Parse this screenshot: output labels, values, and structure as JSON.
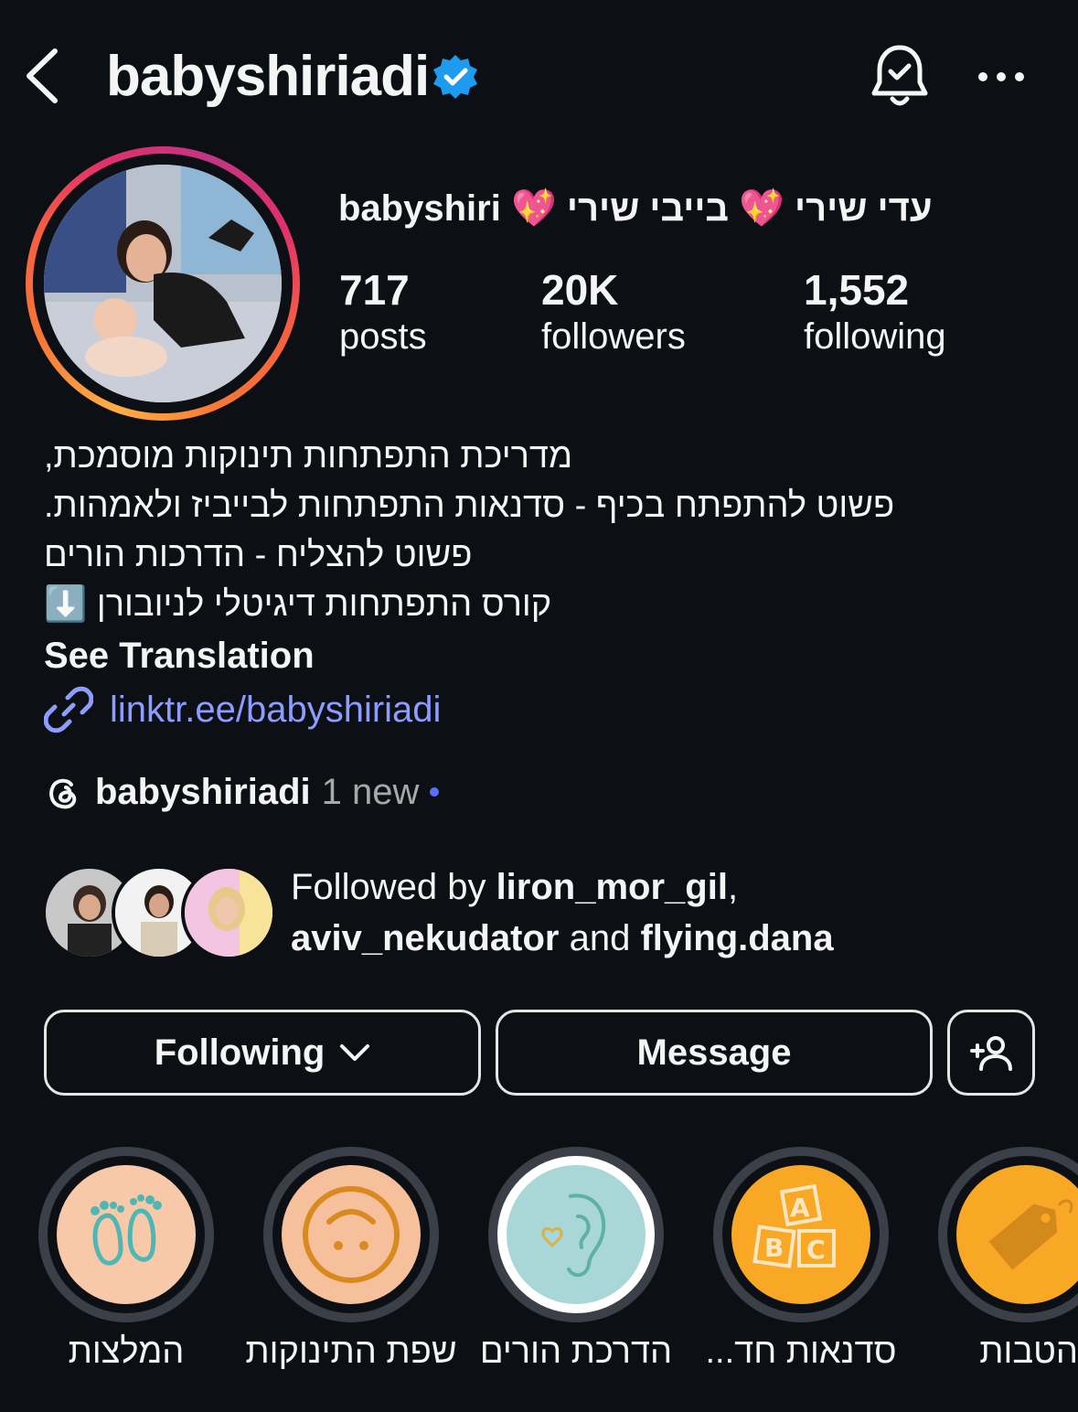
{
  "header": {
    "username": "babyshiriadi",
    "verified_icon": "verified-badge-icon",
    "bell_icon": "notification-bell-icon",
    "more_icon": "more-options-icon"
  },
  "profile": {
    "display_name": "עדי שירי 💖 בייבי שירי 💖 babyshiri",
    "stats": {
      "posts": {
        "value": "717",
        "label": "posts"
      },
      "followers": {
        "value": "20K",
        "label": "followers"
      },
      "following": {
        "value": "1,552",
        "label": "following"
      }
    },
    "bio_lines": [
      "מדריכת התפתחות תינוקות מוסמכת,",
      "פשוט להתפתח בכיף - סדנאות התפתחות לבייביז ולאמהות.",
      "פשוט להצליח - הדרכות הורים",
      "קורס התפתחות דיגיטלי לניובורן ⬇️"
    ],
    "see_translation": "See Translation",
    "link": "linktr.ee/babyshiriadi",
    "threads": {
      "name": "babyshiriadi",
      "badge": "1 new"
    }
  },
  "followed_by": {
    "prefix": "Followed by",
    "user1": "liron_mor_gil",
    "comma": ",",
    "user2": "aviv_nekudator",
    "and": "and",
    "user3": "flying.dana"
  },
  "buttons": {
    "following": "Following",
    "message": "Message"
  },
  "highlights": [
    {
      "label": "המלצות",
      "color": "#f8c9a8"
    },
    {
      "label": "שפת התינוקות",
      "color": "#f7c09c"
    },
    {
      "label": "הדרכת הורים",
      "color": "#a9d6d6"
    },
    {
      "label": "סדנאות חד...",
      "color": "#f9a825"
    },
    {
      "label": "הטבות",
      "color": "#f9a825"
    }
  ],
  "colors": {
    "background": "#0c1014",
    "link": "#8c9dff",
    "verified": "#1d9bf0"
  }
}
